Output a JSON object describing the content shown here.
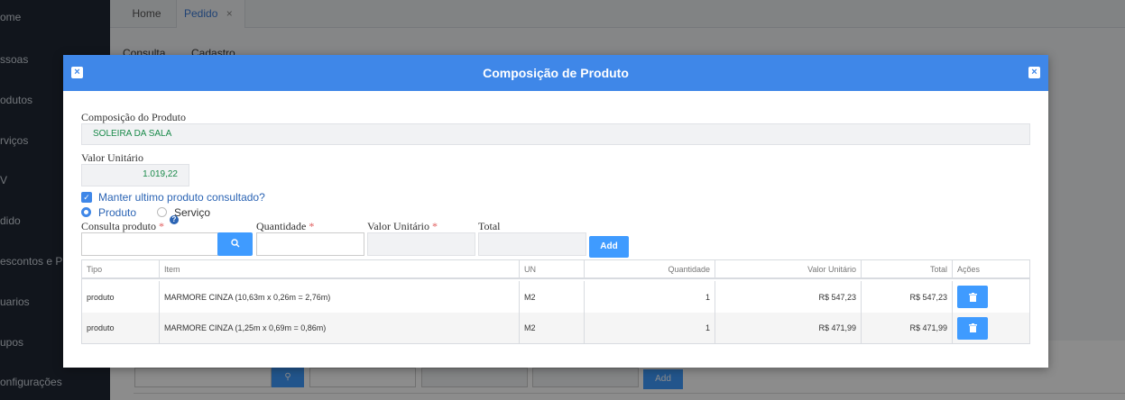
{
  "sidebar": {
    "items": [
      "ome",
      "ssoas",
      "odutos",
      "rviços",
      "V",
      "dido",
      "escontos e Pro",
      "uarios",
      "upos",
      "onfigurações"
    ]
  },
  "tabs": {
    "home": "Home",
    "pedido": "Pedido",
    "pedido_close": "×"
  },
  "subtabs": {
    "consulta": "Consulta",
    "cadastro": "Cadastro"
  },
  "background": {
    "add_label": "Add"
  },
  "modal": {
    "title": "Composição de Produto",
    "close_glyph": "×",
    "composicao_label": "Composição do Produto",
    "composicao_value": "SOLEIRA DA SALA",
    "valor_unitario_label": "Valor Unitário",
    "valor_unitario_value": "1.019,22",
    "manter_label": "Manter ultimo produto consultado?",
    "produto_option": "Produto",
    "servico_option": "Serviço",
    "consulta_produto_label": "Consulta produto",
    "quantidade_label": "Quantidade",
    "valor_unitario_input_label": "Valor Unitário",
    "total_label": "Total",
    "required_mark": "*",
    "help_glyph": "?",
    "add_label": "Add"
  },
  "table": {
    "headers": {
      "tipo": "Tipo",
      "item": "Item",
      "un": "UN",
      "quantidade": "Quantidade",
      "valor_unitario": "Valor Unitário",
      "total": "Total",
      "acoes": "Ações"
    },
    "rows": [
      {
        "tipo": "produto",
        "item": "MARMORE CINZA (10,63m x 0,26m = 2,76m)",
        "un": "M2",
        "quantidade": "1",
        "valor_unitario": "R$ 547,23",
        "total": "R$ 547,23"
      },
      {
        "tipo": "produto",
        "item": "MARMORE CINZA (1,25m x 0,69m = 0,86m)",
        "un": "M2",
        "quantidade": "1",
        "valor_unitario": "R$ 471,99",
        "total": "R$ 471,99"
      }
    ]
  },
  "colors": {
    "primary": "#3f87e8",
    "button": "#3f9bff",
    "value_text": "#1a8a4a"
  }
}
